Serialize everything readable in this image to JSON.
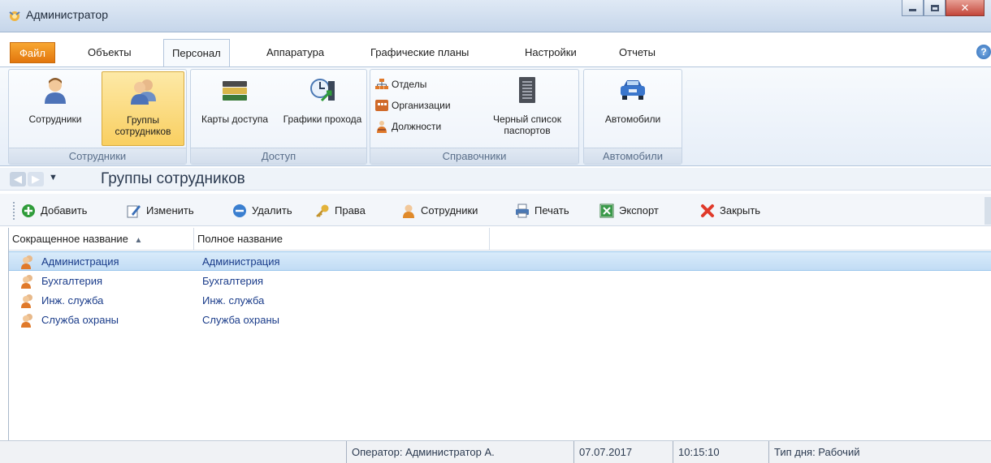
{
  "window": {
    "title": "Администратор"
  },
  "tabs": [
    {
      "label": "Файл"
    },
    {
      "label": "Объекты"
    },
    {
      "label": "Персонал"
    },
    {
      "label": "Аппаратура"
    },
    {
      "label": "Графические планы"
    },
    {
      "label": "Настройки"
    },
    {
      "label": "Отчеты"
    }
  ],
  "help": {
    "label": "?"
  },
  "ribbon": {
    "groups": {
      "staff": {
        "label": "Сотрудники",
        "buttons": [
          {
            "label": "Сотрудники",
            "icon": "person-icon"
          },
          {
            "label": "Группы сотрудников",
            "icon": "group-icon"
          }
        ]
      },
      "access": {
        "label": "Доступ",
        "buttons": [
          {
            "label": "Карты доступа",
            "icon": "cards-icon"
          },
          {
            "label": "Графики прохода",
            "icon": "schedule-clock-icon"
          }
        ]
      },
      "refs": {
        "label": "Справочники",
        "items": [
          {
            "label": "Отделы",
            "icon": "departments-icon"
          },
          {
            "label": "Организации",
            "icon": "organizations-icon"
          },
          {
            "label": "Должности",
            "icon": "positions-icon"
          }
        ],
        "buttons": [
          {
            "label": "Черный список паспортов",
            "icon": "blacklist-icon"
          }
        ]
      },
      "cars": {
        "label": "Автомобили",
        "buttons": [
          {
            "label": "Автомобили",
            "icon": "car-icon"
          }
        ]
      }
    }
  },
  "nav": {
    "title": "Группы сотрудников"
  },
  "toolbar": {
    "add": "Добавить",
    "edit": "Изменить",
    "delete": "Удалить",
    "rights": "Права",
    "staff": "Сотрудники",
    "print": "Печать",
    "export": "Экспорт",
    "close": "Закрыть"
  },
  "grid": {
    "columns": [
      "Сокращенное название",
      "Полное название"
    ],
    "sort": "ascending",
    "rows": [
      {
        "short": "Администрация",
        "full": "Администрация"
      },
      {
        "short": "Бухгалтерия",
        "full": "Бухгалтерия"
      },
      {
        "short": "Инж. служба",
        "full": "Инж. служба"
      },
      {
        "short": "Служба охраны",
        "full": "Служба охраны"
      }
    ],
    "selected_row": 0
  },
  "status": {
    "operator": "Оператор:  Администратор А.",
    "date": "07.07.2017",
    "time": "10:15:10",
    "day_type": "Тип дня:  Рабочий"
  },
  "colors": {
    "accent": "#f39a21",
    "selection": "#c1dcf5",
    "link_text": "#1a3c8a"
  }
}
